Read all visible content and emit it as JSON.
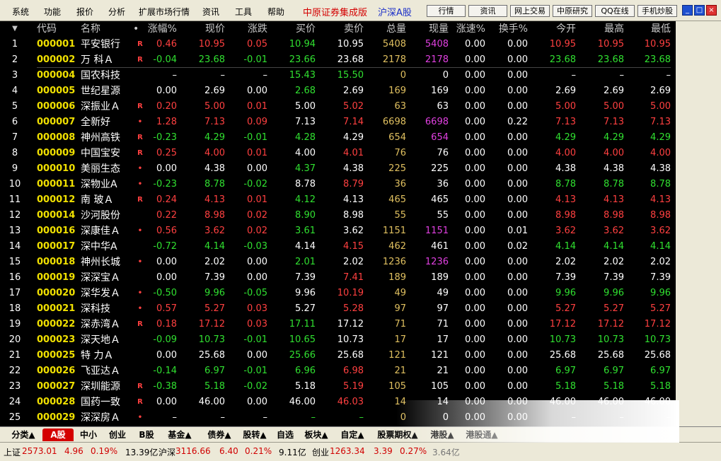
{
  "menu": [
    "系统",
    "功能",
    "报价",
    "分析",
    "扩展市场行情",
    "资讯",
    "工具",
    "帮助"
  ],
  "brand": "中原证券集成版",
  "market": "沪深A股",
  "toolbar": [
    "行情",
    "资讯",
    "网上交易",
    "中原研究",
    "QQ在线",
    "手机炒股"
  ],
  "window_controls": [
    "_",
    "□",
    "×"
  ],
  "headers": [
    "",
    "代码",
    "名称",
    "•",
    "涨幅%",
    "现价",
    "涨跌",
    "买价",
    "卖价",
    "总量",
    "现量",
    "涨速%",
    "换手%",
    "今开",
    "最高",
    "最低"
  ],
  "colors": {
    "up": "#ff4040",
    "down": "#30e030",
    "flat": "#ffffff",
    "code": "#f0e000",
    "vol": "#e0c060",
    "cur_vol_hl": "#e040e0"
  },
  "rows": [
    {
      "n": "1",
      "code": "000001",
      "name": "平安银行",
      "flag": "R",
      "chg": "0.46",
      "price": "10.95",
      "diff": "0.05",
      "bid": "10.94",
      "ask": "10.95",
      "vol": "5408",
      "cur": "5408",
      "spd": "0.00",
      "turn": "0.00",
      "open": "10.95",
      "high": "10.95",
      "low": "10.95",
      "dir": "up",
      "cur_hl": true
    },
    {
      "n": "2",
      "code": "000002",
      "name": "万 科Ａ",
      "flag": "R",
      "chg": "-0.04",
      "price": "23.68",
      "diff": "-0.01",
      "bid": "23.66",
      "ask": "23.68",
      "vol": "2178",
      "cur": "2178",
      "spd": "0.00",
      "turn": "0.00",
      "open": "23.68",
      "high": "23.68",
      "low": "23.68",
      "dir": "down",
      "cur_hl": true
    },
    {
      "n": "3",
      "code": "000004",
      "name": "国农科技",
      "flag": "",
      "chg": "–",
      "price": "–",
      "diff": "–",
      "bid": "15.43",
      "ask": "15.50",
      "vol": "0",
      "cur": "0",
      "spd": "0.00",
      "turn": "0.00",
      "open": "–",
      "high": "–",
      "low": "–",
      "dir": "flat",
      "cur_hl": false
    },
    {
      "n": "4",
      "code": "000005",
      "name": "世纪星源",
      "flag": "",
      "chg": "0.00",
      "price": "2.69",
      "diff": "0.00",
      "bid": "2.68",
      "ask": "2.69",
      "vol": "169",
      "cur": "169",
      "spd": "0.00",
      "turn": "0.00",
      "open": "2.69",
      "high": "2.69",
      "low": "2.69",
      "dir": "flat",
      "cur_hl": false
    },
    {
      "n": "5",
      "code": "000006",
      "name": "深振业Ａ",
      "flag": "R",
      "chg": "0.20",
      "price": "5.00",
      "diff": "0.01",
      "bid": "5.00",
      "ask": "5.02",
      "vol": "63",
      "cur": "63",
      "spd": "0.00",
      "turn": "0.00",
      "open": "5.00",
      "high": "5.00",
      "low": "5.00",
      "dir": "up",
      "cur_hl": false
    },
    {
      "n": "6",
      "code": "000007",
      "name": "全新好",
      "flag": "•",
      "chg": "1.28",
      "price": "7.13",
      "diff": "0.09",
      "bid": "7.13",
      "ask": "7.14",
      "vol": "6698",
      "cur": "6698",
      "spd": "0.00",
      "turn": "0.22",
      "open": "7.13",
      "high": "7.13",
      "low": "7.13",
      "dir": "up",
      "cur_hl": true
    },
    {
      "n": "7",
      "code": "000008",
      "name": "神州高铁",
      "flag": "R",
      "chg": "-0.23",
      "price": "4.29",
      "diff": "-0.01",
      "bid": "4.28",
      "ask": "4.29",
      "vol": "654",
      "cur": "654",
      "spd": "0.00",
      "turn": "0.00",
      "open": "4.29",
      "high": "4.29",
      "low": "4.29",
      "dir": "down",
      "cur_hl": true
    },
    {
      "n": "8",
      "code": "000009",
      "name": "中国宝安",
      "flag": "R",
      "chg": "0.25",
      "price": "4.00",
      "diff": "0.01",
      "bid": "4.00",
      "ask": "4.01",
      "vol": "76",
      "cur": "76",
      "spd": "0.00",
      "turn": "0.00",
      "open": "4.00",
      "high": "4.00",
      "low": "4.00",
      "dir": "up",
      "cur_hl": false
    },
    {
      "n": "9",
      "code": "000010",
      "name": "美丽生态",
      "flag": "•",
      "chg": "0.00",
      "price": "4.38",
      "diff": "0.00",
      "bid": "4.37",
      "ask": "4.38",
      "vol": "225",
      "cur": "225",
      "spd": "0.00",
      "turn": "0.00",
      "open": "4.38",
      "high": "4.38",
      "low": "4.38",
      "dir": "flat",
      "cur_hl": false
    },
    {
      "n": "10",
      "code": "000011",
      "name": "深物业A",
      "flag": "•",
      "chg": "-0.23",
      "price": "8.78",
      "diff": "-0.02",
      "bid": "8.78",
      "ask": "8.79",
      "vol": "36",
      "cur": "36",
      "spd": "0.00",
      "turn": "0.00",
      "open": "8.78",
      "high": "8.78",
      "low": "8.78",
      "dir": "down",
      "cur_hl": false
    },
    {
      "n": "11",
      "code": "000012",
      "name": "南 玻Ａ",
      "flag": "R",
      "chg": "0.24",
      "price": "4.13",
      "diff": "0.01",
      "bid": "4.12",
      "ask": "4.13",
      "vol": "465",
      "cur": "465",
      "spd": "0.00",
      "turn": "0.00",
      "open": "4.13",
      "high": "4.13",
      "low": "4.13",
      "dir": "up",
      "cur_hl": false
    },
    {
      "n": "12",
      "code": "000014",
      "name": "沙河股份",
      "flag": "",
      "chg": "0.22",
      "price": "8.98",
      "diff": "0.02",
      "bid": "8.90",
      "ask": "8.98",
      "vol": "55",
      "cur": "55",
      "spd": "0.00",
      "turn": "0.00",
      "open": "8.98",
      "high": "8.98",
      "low": "8.98",
      "dir": "up",
      "cur_hl": false
    },
    {
      "n": "13",
      "code": "000016",
      "name": "深康佳Ａ",
      "flag": "•",
      "chg": "0.56",
      "price": "3.62",
      "diff": "0.02",
      "bid": "3.61",
      "ask": "3.62",
      "vol": "1151",
      "cur": "1151",
      "spd": "0.00",
      "turn": "0.01",
      "open": "3.62",
      "high": "3.62",
      "low": "3.62",
      "dir": "up",
      "cur_hl": true
    },
    {
      "n": "14",
      "code": "000017",
      "name": "深中华A",
      "flag": "",
      "chg": "-0.72",
      "price": "4.14",
      "diff": "-0.03",
      "bid": "4.14",
      "ask": "4.15",
      "vol": "462",
      "cur": "461",
      "spd": "0.00",
      "turn": "0.02",
      "open": "4.14",
      "high": "4.14",
      "low": "4.14",
      "dir": "down",
      "cur_hl": false
    },
    {
      "n": "15",
      "code": "000018",
      "name": "神州长城",
      "flag": "•",
      "chg": "0.00",
      "price": "2.02",
      "diff": "0.00",
      "bid": "2.01",
      "ask": "2.02",
      "vol": "1236",
      "cur": "1236",
      "spd": "0.00",
      "turn": "0.00",
      "open": "2.02",
      "high": "2.02",
      "low": "2.02",
      "dir": "flat",
      "cur_hl": true
    },
    {
      "n": "16",
      "code": "000019",
      "name": "深深宝Ａ",
      "flag": "",
      "chg": "0.00",
      "price": "7.39",
      "diff": "0.00",
      "bid": "7.39",
      "ask": "7.41",
      "vol": "189",
      "cur": "189",
      "spd": "0.00",
      "turn": "0.00",
      "open": "7.39",
      "high": "7.39",
      "low": "7.39",
      "dir": "flat",
      "cur_hl": false
    },
    {
      "n": "17",
      "code": "000020",
      "name": "深华发Ａ",
      "flag": "•",
      "chg": "-0.50",
      "price": "9.96",
      "diff": "-0.05",
      "bid": "9.96",
      "ask": "10.19",
      "vol": "49",
      "cur": "49",
      "spd": "0.00",
      "turn": "0.00",
      "open": "9.96",
      "high": "9.96",
      "low": "9.96",
      "dir": "down",
      "cur_hl": false
    },
    {
      "n": "18",
      "code": "000021",
      "name": "深科技",
      "flag": "•",
      "chg": "0.57",
      "price": "5.27",
      "diff": "0.03",
      "bid": "5.27",
      "ask": "5.28",
      "vol": "97",
      "cur": "97",
      "spd": "0.00",
      "turn": "0.00",
      "open": "5.27",
      "high": "5.27",
      "low": "5.27",
      "dir": "up",
      "cur_hl": false
    },
    {
      "n": "19",
      "code": "000022",
      "name": "深赤湾Ａ",
      "flag": "R",
      "chg": "0.18",
      "price": "17.12",
      "diff": "0.03",
      "bid": "17.11",
      "ask": "17.12",
      "vol": "71",
      "cur": "71",
      "spd": "0.00",
      "turn": "0.00",
      "open": "17.12",
      "high": "17.12",
      "low": "17.12",
      "dir": "up",
      "cur_hl": false
    },
    {
      "n": "20",
      "code": "000023",
      "name": "深天地Ａ",
      "flag": "",
      "chg": "-0.09",
      "price": "10.73",
      "diff": "-0.01",
      "bid": "10.65",
      "ask": "10.73",
      "vol": "17",
      "cur": "17",
      "spd": "0.00",
      "turn": "0.00",
      "open": "10.73",
      "high": "10.73",
      "low": "10.73",
      "dir": "down",
      "cur_hl": false
    },
    {
      "n": "21",
      "code": "000025",
      "name": "特 力Ａ",
      "flag": "",
      "chg": "0.00",
      "price": "25.68",
      "diff": "0.00",
      "bid": "25.66",
      "ask": "25.68",
      "vol": "121",
      "cur": "121",
      "spd": "0.00",
      "turn": "0.00",
      "open": "25.68",
      "high": "25.68",
      "low": "25.68",
      "dir": "flat",
      "cur_hl": false
    },
    {
      "n": "22",
      "code": "000026",
      "name": "飞亚达Ａ",
      "flag": "",
      "chg": "-0.14",
      "price": "6.97",
      "diff": "-0.01",
      "bid": "6.96",
      "ask": "6.98",
      "vol": "21",
      "cur": "21",
      "spd": "0.00",
      "turn": "0.00",
      "open": "6.97",
      "high": "6.97",
      "low": "6.97",
      "dir": "down",
      "cur_hl": false
    },
    {
      "n": "23",
      "code": "000027",
      "name": "深圳能源",
      "flag": "R",
      "chg": "-0.38",
      "price": "5.18",
      "diff": "-0.02",
      "bid": "5.18",
      "ask": "5.19",
      "vol": "105",
      "cur": "105",
      "spd": "0.00",
      "turn": "0.00",
      "open": "5.18",
      "high": "5.18",
      "low": "5.18",
      "dir": "down",
      "cur_hl": false
    },
    {
      "n": "24",
      "code": "000028",
      "name": "国药一致",
      "flag": "R",
      "chg": "0.00",
      "price": "46.00",
      "diff": "0.00",
      "bid": "46.00",
      "ask": "46.03",
      "vol": "14",
      "cur": "14",
      "spd": "0.00",
      "turn": "0.00",
      "open": "46.00",
      "high": "46.00",
      "low": "46.00",
      "dir": "flat",
      "cur_hl": false
    },
    {
      "n": "25",
      "code": "000029",
      "name": "深深房Ａ",
      "flag": "•",
      "chg": "–",
      "price": "–",
      "diff": "–",
      "bid": "–",
      "ask": "–",
      "vol": "0",
      "cur": "0",
      "spd": "0.00",
      "turn": "0.00",
      "open": "–",
      "high": "–",
      "low": "–",
      "dir": "flat",
      "cur_hl": false
    }
  ],
  "tabs": [
    "分类▲",
    "A股",
    "中小",
    "创业",
    "B股",
    "基金▲",
    "债券▲",
    "股转▲",
    "自选",
    "板块▲",
    "自定▲",
    "股票期权▲",
    "港股▲",
    "港股通▲"
  ],
  "active_tab": "A股",
  "status": {
    "sh_label": "上证",
    "sh_idx": "2573.01",
    "sh_chg": "4.96",
    "sh_pct": "0.19%",
    "sh_amt": "13.39亿",
    "hs_label": "沪深",
    "hs_idx": "3116.66",
    "hs_chg": "6.40",
    "hs_pct": "0.21%",
    "hs_amt": "9.11亿",
    "cy_label": "创业",
    "cy_idx": "1263.34",
    "cy_chg": "3.39",
    "cy_pct": "0.27%",
    "cy_amt": "3.64亿"
  }
}
